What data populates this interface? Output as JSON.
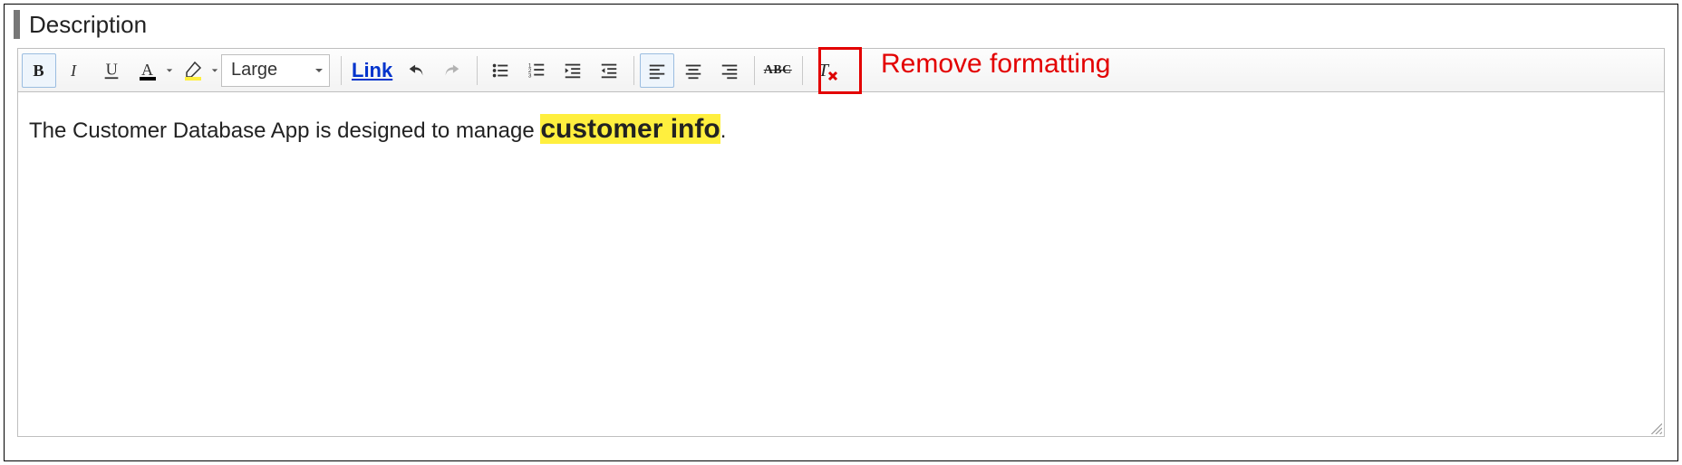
{
  "field": {
    "label": "Description"
  },
  "toolbar": {
    "bold_icon": "bold",
    "italic_icon": "italic",
    "underline_icon": "underline",
    "text_color_icon": "text-color",
    "highlight_icon": "highlight",
    "font_size": {
      "selected": "Large"
    },
    "link_label": "Link",
    "undo_icon": "undo",
    "redo_icon": "redo",
    "bullet_list_icon": "bullet-list",
    "number_list_icon": "number-list",
    "indent_icon": "indent",
    "outdent_icon": "outdent",
    "align_left_icon": "align-left",
    "align_center_icon": "align-center",
    "align_right_icon": "align-right",
    "strike_icon": "strikethrough",
    "strike_text": "ABC",
    "remove_format_icon": "remove-formatting"
  },
  "annotation": {
    "remove_format_label": "Remove formatting"
  },
  "content": {
    "segments": [
      {
        "text": "The Customer Database App is designed to manage ",
        "style": "normal"
      },
      {
        "text": "customer info",
        "style": "big-highlight"
      },
      {
        "text": ".",
        "style": "normal"
      }
    ]
  },
  "colors": {
    "highlight": "#ffef3e",
    "annotation": "#e30000",
    "link": "#0033cc",
    "text_color_bar": "#000000",
    "highlight_bar": "#ffef3e"
  }
}
